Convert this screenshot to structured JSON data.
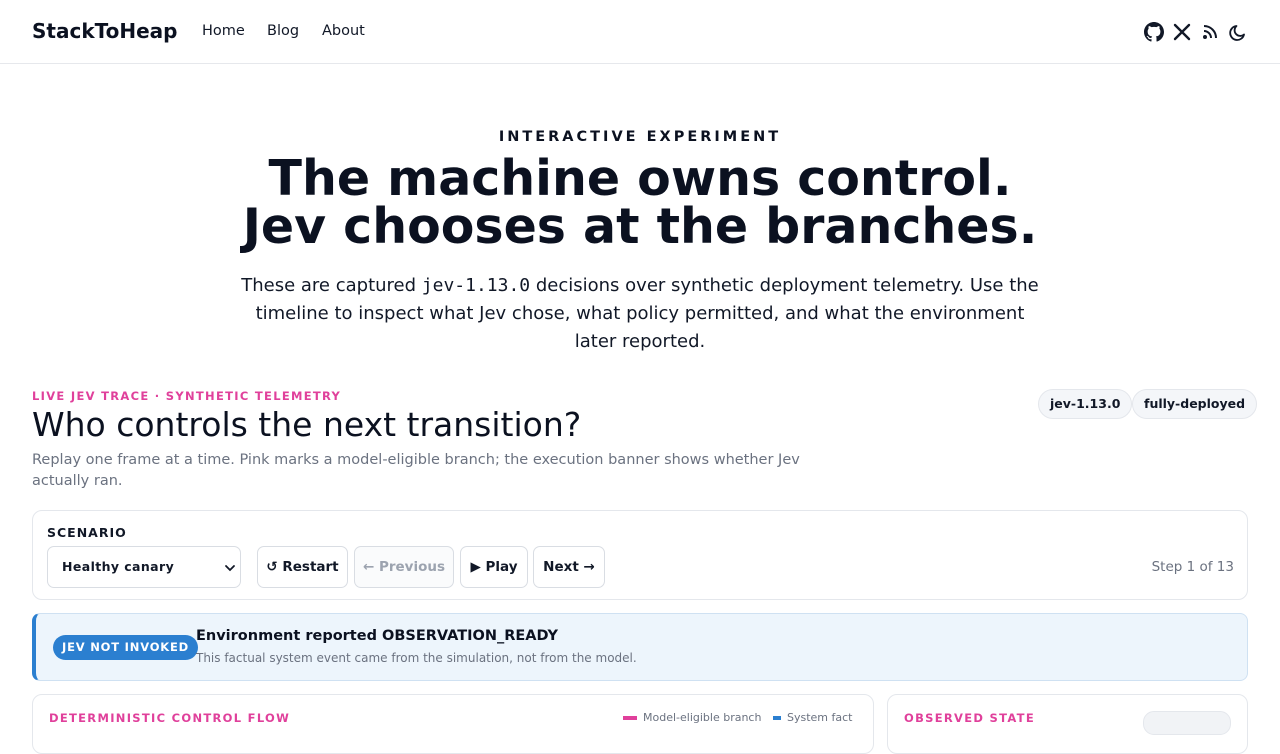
{
  "nav": {
    "brand": "StackToHeap",
    "links": [
      "Home",
      "Blog",
      "About"
    ],
    "icons": [
      "github-icon",
      "x-icon",
      "rss-icon",
      "moon-icon"
    ]
  },
  "hero": {
    "kicker": "INTERACTIVE EXPERIMENT",
    "title_line1": "The machine owns control.",
    "title_line2": "Jev chooses at the branches.",
    "subtitle_pre": "These are captured ",
    "subtitle_code": "jev-1.13.0",
    "subtitle_post": " decisions over synthetic deployment telemetry. Use the timeline to inspect what Jev chose, what policy permitted, and what the environment later reported."
  },
  "section": {
    "eyebrow": "LIVE JEV TRACE · SYNTHETIC TELEMETRY",
    "title": "Who controls the next transition?",
    "description": "Replay one frame at a time. Pink marks a model-eligible branch; the execution banner shows whether Jev actually ran.",
    "pills": [
      "jev-1.13.0",
      "fully-deployed"
    ]
  },
  "controls": {
    "scenario_label": "SCENARIO",
    "scenario_value": "Healthy canary",
    "restart": "↺ Restart",
    "previous": "← Previous",
    "play": "▶ Play",
    "next": "Next →",
    "step": "Step 1 of 13"
  },
  "banner": {
    "badge": "JEV NOT INVOKED",
    "title": "Environment reported OBSERVATION_READY",
    "description": "This factual system event came from the simulation, not from the model."
  },
  "panels": {
    "flow_heading": "DETERMINISTIC CONTROL FLOW",
    "legend_model": "Model-eligible branch",
    "legend_system": "System fact",
    "state_heading": "OBSERVED STATE"
  },
  "colors": {
    "accent_pink": "#e0409b",
    "accent_blue": "#2b7fd0",
    "banner_bg": "#edf5fc"
  }
}
